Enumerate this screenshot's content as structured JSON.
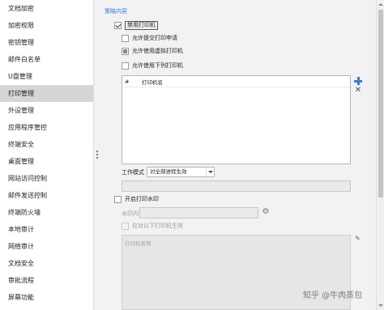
{
  "sidebar": {
    "items": [
      {
        "label": "文档加密"
      },
      {
        "label": "加密权限"
      },
      {
        "label": "密钥管理"
      },
      {
        "label": "邮件白名单"
      },
      {
        "label": "U盘管理"
      },
      {
        "label": "打印管理",
        "active": true
      },
      {
        "label": "外设管理"
      },
      {
        "label": "应用程序管控"
      },
      {
        "label": "终端安全"
      },
      {
        "label": "桌面管理"
      },
      {
        "label": "网站访问控制"
      },
      {
        "label": "邮件发送控制"
      },
      {
        "label": "终端防火墙"
      },
      {
        "label": "本地审计"
      },
      {
        "label": "网络审计"
      },
      {
        "label": "文档安全"
      },
      {
        "label": "审批流程"
      },
      {
        "label": "屏幕功能"
      }
    ]
  },
  "policy": {
    "section_title": "策略内容",
    "disable_printer": "禁用打印机",
    "allow_submit_request": "允许提交打印申请",
    "allow_virtual_printer": "允许使用虚拟打印机",
    "allow_listed_printers": "允许使用下列打印机",
    "table_col_index": "#",
    "table_col_name": "打印机名",
    "mode_label": "工作模式",
    "mode_value": "对全部进程生效",
    "enable_watermark": "开启打印水印",
    "watermark_content_label": "水印内容:",
    "watermark_only_listed": "仅对以下打印机生效",
    "watermark_printer_placeholder": "打印机名称"
  },
  "icons": {
    "add": "plus-icon",
    "delete": "close-icon",
    "settings": "gear-icon",
    "edit": "pencil-icon",
    "accent_color": "#3a7bd5"
  },
  "watermark": {
    "text": "知乎 @牛肉蒸包"
  }
}
